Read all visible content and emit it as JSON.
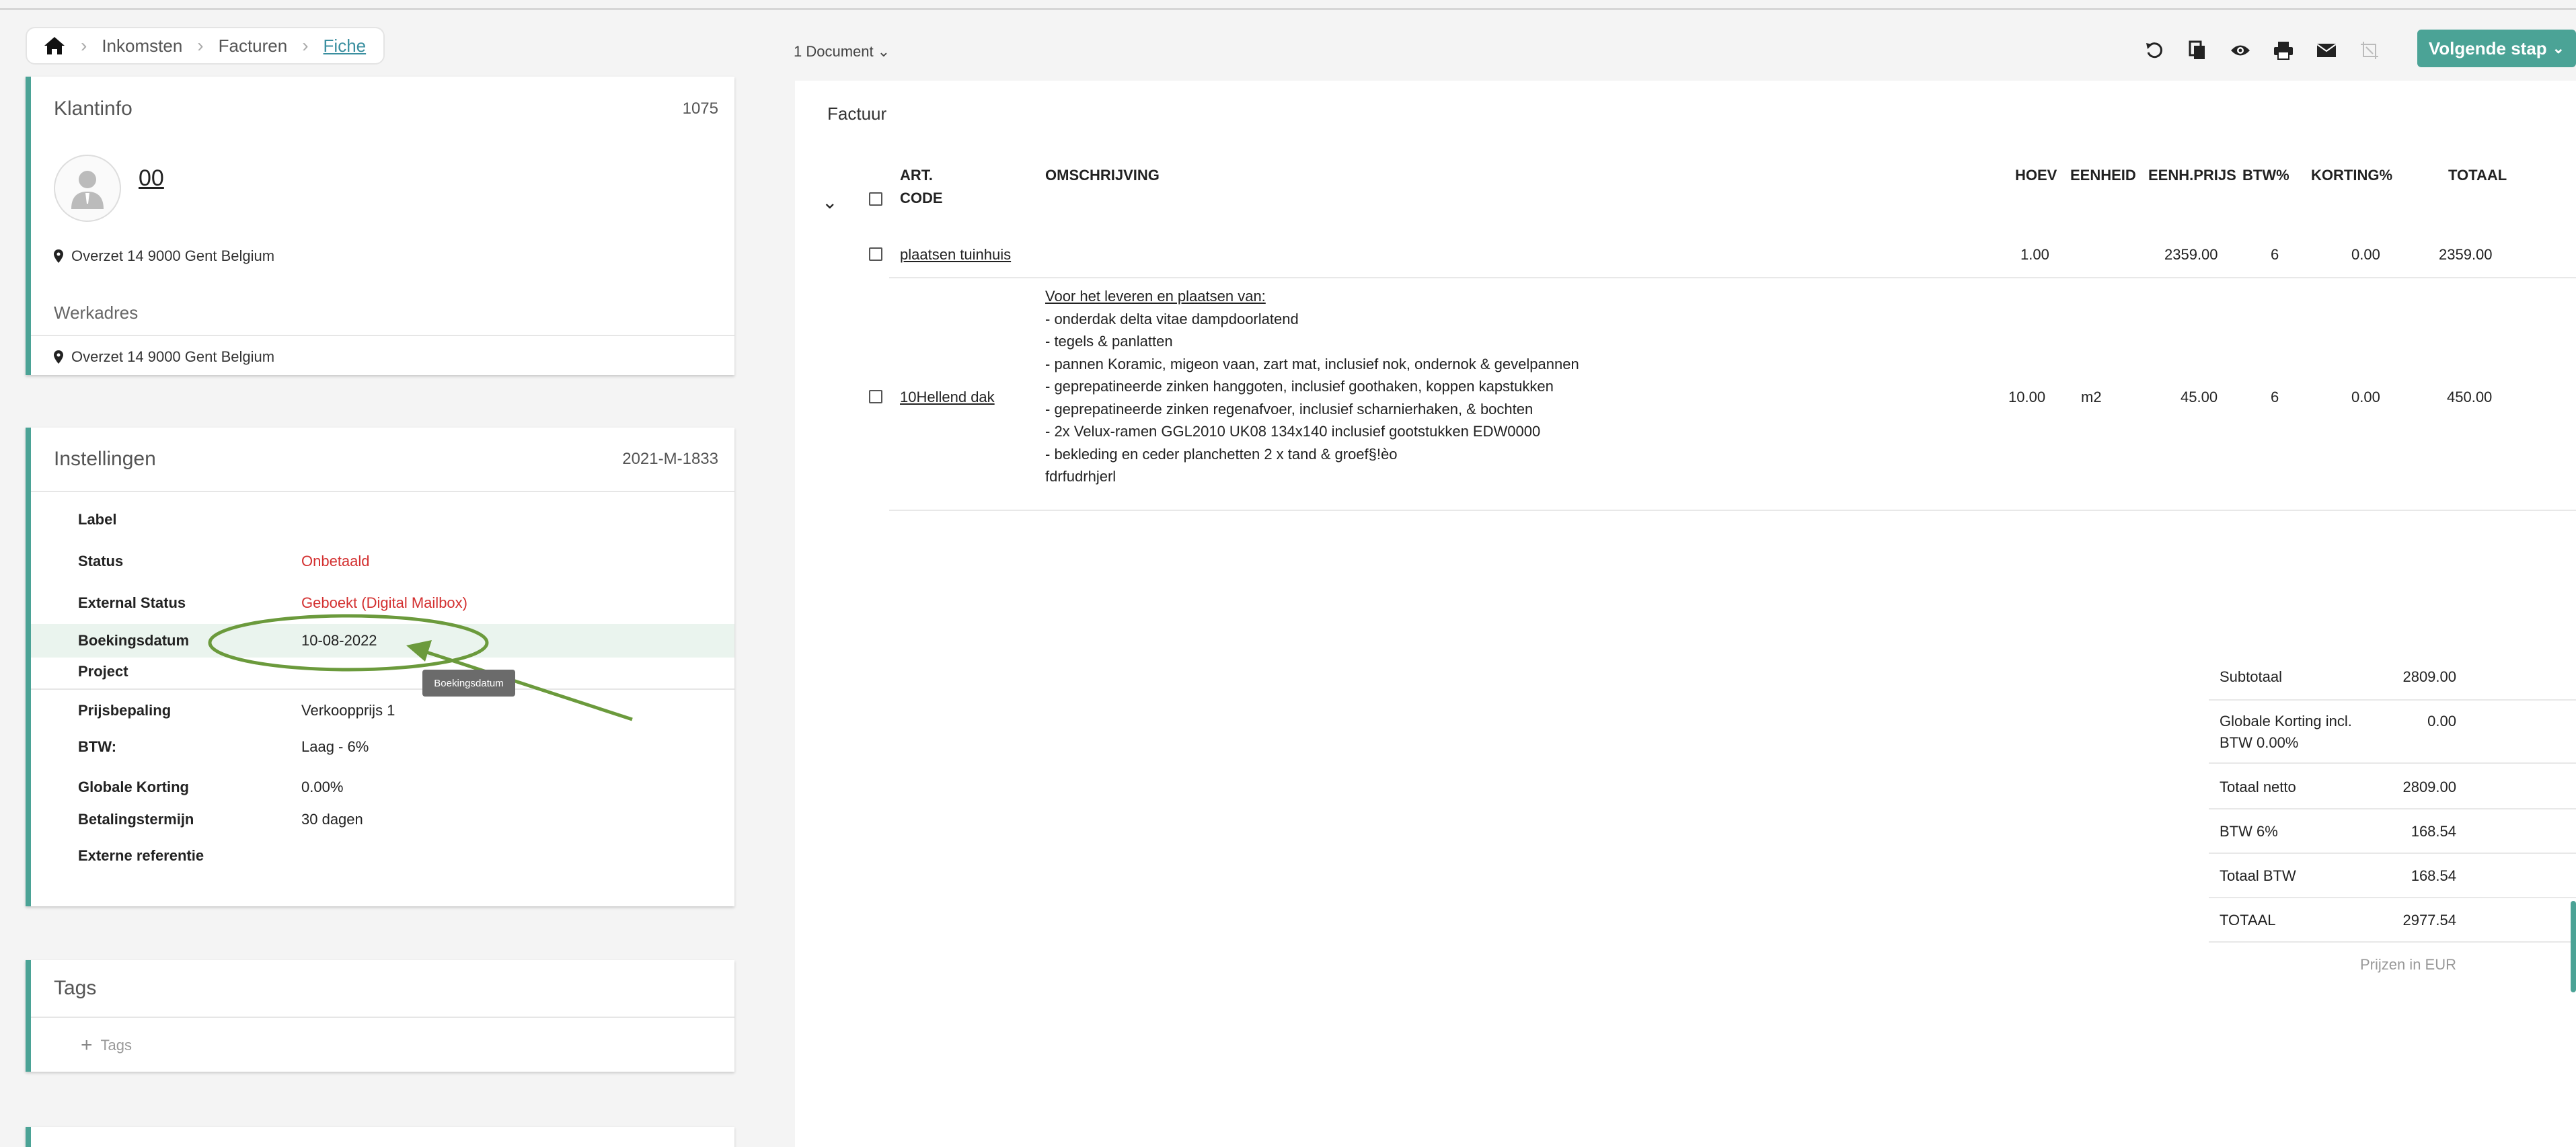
{
  "breadcrumb": {
    "items": [
      "Inkomsten",
      "Facturen"
    ],
    "current": "Fiche"
  },
  "klantinfo": {
    "title": "Klantinfo",
    "id": "1075",
    "name": "00",
    "address": "Overzet 14 9000 Gent Belgium",
    "werkadres_label": "Werkadres",
    "werkadres": "Overzet 14 9000 Gent Belgium"
  },
  "instellingen": {
    "title": "Instellingen",
    "id": "2021-M-1833",
    "rows": [
      {
        "label": "Label",
        "value": ""
      },
      {
        "label": "Status",
        "value": "Onbetaald"
      },
      {
        "label": "External Status",
        "value": "Geboekt (Digital Mailbox)"
      },
      {
        "label": "Boekingsdatum",
        "value": "10-08-2022"
      },
      {
        "label": "Project",
        "value": ""
      },
      {
        "label": "Prijsbepaling",
        "value": "Verkoopprijs 1"
      },
      {
        "label": "BTW:",
        "value": "Laag - 6%"
      },
      {
        "label": "Globale Korting",
        "value": "0.00%"
      },
      {
        "label": "Betalingstermijn",
        "value": "30 dagen"
      },
      {
        "label": "Externe referentie",
        "value": ""
      }
    ],
    "tooltip": "Boekingsdatum"
  },
  "tags": {
    "title": "Tags",
    "add_label": "Tags"
  },
  "colors": {
    "accent": "#4ba396",
    "status_red": "#d32f2f",
    "annotation": "#6b9a3c",
    "link": "#3a8fa0"
  },
  "toolbar": {
    "document_dropdown": "1 Document",
    "icons": [
      "undo-icon",
      "copy-icon",
      "eye-icon",
      "print-icon",
      "mail-icon",
      "crop-icon"
    ],
    "next_step": "Volgende stap"
  },
  "invoice": {
    "title": "Factuur",
    "headers": {
      "art_code_1": "ART.",
      "art_code_2": "CODE",
      "omschrijving": "OMSCHRIJVING",
      "hoev": "HOEV",
      "eenheid": "EENHEID",
      "eenh_prijs": "EENH.PRIJS",
      "btw": "BTW%",
      "korting": "KORTING%",
      "totaal": "TOTAAL"
    },
    "lines": [
      {
        "code": "plaatsen tuinhuis",
        "qty": "1.00",
        "unit": "",
        "price": "2359.00",
        "btw": "6",
        "korting": "0.00",
        "total": "2359.00"
      },
      {
        "code": "10Hellend dak",
        "qty": "10.00",
        "unit": "m2",
        "price": "45.00",
        "btw": "6",
        "korting": "0.00",
        "total": "450.00",
        "desc_title": "Voor het leveren en plaatsen van:",
        "desc_lines": [
          "- onderdak delta vitae dampdoorlatend",
          "- tegels & panlatten",
          "- pannen Koramic, migeon vaan, zart mat, inclusief nok, ondernok & gevelpannen",
          "- geprepatineerde zinken hanggoten, inclusief goothaken, koppen kapstukken",
          "- geprepatineerde zinken regenafvoer, inclusief scharnierhaken, & bochten",
          "- 2x Velux-ramen GGL2010 UK08 134x140 inclusief gootstukken EDW0000",
          "- bekleding en ceder planchetten 2 x tand & groef§!èo",
          "fdrfudrhjerl"
        ]
      }
    ]
  },
  "totals": {
    "subtotaal": {
      "label": "Subtotaal",
      "value": "2809.00"
    },
    "globale_korting": {
      "label1": "Globale Korting incl.",
      "label2": "BTW 0.00%",
      "value": "0.00"
    },
    "totaal_netto": {
      "label": "Totaal netto",
      "value": "2809.00"
    },
    "btw6": {
      "label": "BTW 6%",
      "value": "168.54"
    },
    "totaal_btw": {
      "label": "Totaal BTW",
      "value": "168.54"
    },
    "totaal": {
      "label": "TOTAAL",
      "value": "2977.54"
    },
    "currency_note": "Prijzen in EUR"
  }
}
